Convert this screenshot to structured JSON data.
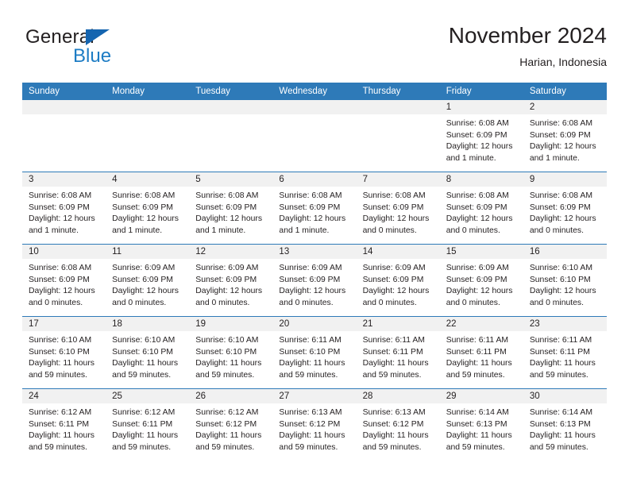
{
  "brand": {
    "word_one": "General",
    "word_two": "Blue",
    "triangle_color": "#1565b0",
    "blue_color": "#1d7cc4"
  },
  "header": {
    "title": "November 2024",
    "subtitle": "Harian, Indonesia"
  },
  "theme": {
    "header_blue": "#2e7ab8",
    "daynum_bg": "#f1f1f1",
    "text": "#231f20"
  },
  "weekdays": [
    "Sunday",
    "Monday",
    "Tuesday",
    "Wednesday",
    "Thursday",
    "Friday",
    "Saturday"
  ],
  "weeks": [
    [
      {
        "day": "",
        "sunrise": "",
        "sunset": "",
        "daylight_1": "",
        "daylight_2": ""
      },
      {
        "day": "",
        "sunrise": "",
        "sunset": "",
        "daylight_1": "",
        "daylight_2": ""
      },
      {
        "day": "",
        "sunrise": "",
        "sunset": "",
        "daylight_1": "",
        "daylight_2": ""
      },
      {
        "day": "",
        "sunrise": "",
        "sunset": "",
        "daylight_1": "",
        "daylight_2": ""
      },
      {
        "day": "",
        "sunrise": "",
        "sunset": "",
        "daylight_1": "",
        "daylight_2": ""
      },
      {
        "day": "1",
        "sunrise": "Sunrise: 6:08 AM",
        "sunset": "Sunset: 6:09 PM",
        "daylight_1": "Daylight: 12 hours",
        "daylight_2": "and 1 minute."
      },
      {
        "day": "2",
        "sunrise": "Sunrise: 6:08 AM",
        "sunset": "Sunset: 6:09 PM",
        "daylight_1": "Daylight: 12 hours",
        "daylight_2": "and 1 minute."
      }
    ],
    [
      {
        "day": "3",
        "sunrise": "Sunrise: 6:08 AM",
        "sunset": "Sunset: 6:09 PM",
        "daylight_1": "Daylight: 12 hours",
        "daylight_2": "and 1 minute."
      },
      {
        "day": "4",
        "sunrise": "Sunrise: 6:08 AM",
        "sunset": "Sunset: 6:09 PM",
        "daylight_1": "Daylight: 12 hours",
        "daylight_2": "and 1 minute."
      },
      {
        "day": "5",
        "sunrise": "Sunrise: 6:08 AM",
        "sunset": "Sunset: 6:09 PM",
        "daylight_1": "Daylight: 12 hours",
        "daylight_2": "and 1 minute."
      },
      {
        "day": "6",
        "sunrise": "Sunrise: 6:08 AM",
        "sunset": "Sunset: 6:09 PM",
        "daylight_1": "Daylight: 12 hours",
        "daylight_2": "and 1 minute."
      },
      {
        "day": "7",
        "sunrise": "Sunrise: 6:08 AM",
        "sunset": "Sunset: 6:09 PM",
        "daylight_1": "Daylight: 12 hours",
        "daylight_2": "and 0 minutes."
      },
      {
        "day": "8",
        "sunrise": "Sunrise: 6:08 AM",
        "sunset": "Sunset: 6:09 PM",
        "daylight_1": "Daylight: 12 hours",
        "daylight_2": "and 0 minutes."
      },
      {
        "day": "9",
        "sunrise": "Sunrise: 6:08 AM",
        "sunset": "Sunset: 6:09 PM",
        "daylight_1": "Daylight: 12 hours",
        "daylight_2": "and 0 minutes."
      }
    ],
    [
      {
        "day": "10",
        "sunrise": "Sunrise: 6:08 AM",
        "sunset": "Sunset: 6:09 PM",
        "daylight_1": "Daylight: 12 hours",
        "daylight_2": "and 0 minutes."
      },
      {
        "day": "11",
        "sunrise": "Sunrise: 6:09 AM",
        "sunset": "Sunset: 6:09 PM",
        "daylight_1": "Daylight: 12 hours",
        "daylight_2": "and 0 minutes."
      },
      {
        "day": "12",
        "sunrise": "Sunrise: 6:09 AM",
        "sunset": "Sunset: 6:09 PM",
        "daylight_1": "Daylight: 12 hours",
        "daylight_2": "and 0 minutes."
      },
      {
        "day": "13",
        "sunrise": "Sunrise: 6:09 AM",
        "sunset": "Sunset: 6:09 PM",
        "daylight_1": "Daylight: 12 hours",
        "daylight_2": "and 0 minutes."
      },
      {
        "day": "14",
        "sunrise": "Sunrise: 6:09 AM",
        "sunset": "Sunset: 6:09 PM",
        "daylight_1": "Daylight: 12 hours",
        "daylight_2": "and 0 minutes."
      },
      {
        "day": "15",
        "sunrise": "Sunrise: 6:09 AM",
        "sunset": "Sunset: 6:09 PM",
        "daylight_1": "Daylight: 12 hours",
        "daylight_2": "and 0 minutes."
      },
      {
        "day": "16",
        "sunrise": "Sunrise: 6:10 AM",
        "sunset": "Sunset: 6:10 PM",
        "daylight_1": "Daylight: 12 hours",
        "daylight_2": "and 0 minutes."
      }
    ],
    [
      {
        "day": "17",
        "sunrise": "Sunrise: 6:10 AM",
        "sunset": "Sunset: 6:10 PM",
        "daylight_1": "Daylight: 11 hours",
        "daylight_2": "and 59 minutes."
      },
      {
        "day": "18",
        "sunrise": "Sunrise: 6:10 AM",
        "sunset": "Sunset: 6:10 PM",
        "daylight_1": "Daylight: 11 hours",
        "daylight_2": "and 59 minutes."
      },
      {
        "day": "19",
        "sunrise": "Sunrise: 6:10 AM",
        "sunset": "Sunset: 6:10 PM",
        "daylight_1": "Daylight: 11 hours",
        "daylight_2": "and 59 minutes."
      },
      {
        "day": "20",
        "sunrise": "Sunrise: 6:11 AM",
        "sunset": "Sunset: 6:10 PM",
        "daylight_1": "Daylight: 11 hours",
        "daylight_2": "and 59 minutes."
      },
      {
        "day": "21",
        "sunrise": "Sunrise: 6:11 AM",
        "sunset": "Sunset: 6:11 PM",
        "daylight_1": "Daylight: 11 hours",
        "daylight_2": "and 59 minutes."
      },
      {
        "day": "22",
        "sunrise": "Sunrise: 6:11 AM",
        "sunset": "Sunset: 6:11 PM",
        "daylight_1": "Daylight: 11 hours",
        "daylight_2": "and 59 minutes."
      },
      {
        "day": "23",
        "sunrise": "Sunrise: 6:11 AM",
        "sunset": "Sunset: 6:11 PM",
        "daylight_1": "Daylight: 11 hours",
        "daylight_2": "and 59 minutes."
      }
    ],
    [
      {
        "day": "24",
        "sunrise": "Sunrise: 6:12 AM",
        "sunset": "Sunset: 6:11 PM",
        "daylight_1": "Daylight: 11 hours",
        "daylight_2": "and 59 minutes."
      },
      {
        "day": "25",
        "sunrise": "Sunrise: 6:12 AM",
        "sunset": "Sunset: 6:11 PM",
        "daylight_1": "Daylight: 11 hours",
        "daylight_2": "and 59 minutes."
      },
      {
        "day": "26",
        "sunrise": "Sunrise: 6:12 AM",
        "sunset": "Sunset: 6:12 PM",
        "daylight_1": "Daylight: 11 hours",
        "daylight_2": "and 59 minutes."
      },
      {
        "day": "27",
        "sunrise": "Sunrise: 6:13 AM",
        "sunset": "Sunset: 6:12 PM",
        "daylight_1": "Daylight: 11 hours",
        "daylight_2": "and 59 minutes."
      },
      {
        "day": "28",
        "sunrise": "Sunrise: 6:13 AM",
        "sunset": "Sunset: 6:12 PM",
        "daylight_1": "Daylight: 11 hours",
        "daylight_2": "and 59 minutes."
      },
      {
        "day": "29",
        "sunrise": "Sunrise: 6:14 AM",
        "sunset": "Sunset: 6:13 PM",
        "daylight_1": "Daylight: 11 hours",
        "daylight_2": "and 59 minutes."
      },
      {
        "day": "30",
        "sunrise": "Sunrise: 6:14 AM",
        "sunset": "Sunset: 6:13 PM",
        "daylight_1": "Daylight: 11 hours",
        "daylight_2": "and 59 minutes."
      }
    ]
  ]
}
